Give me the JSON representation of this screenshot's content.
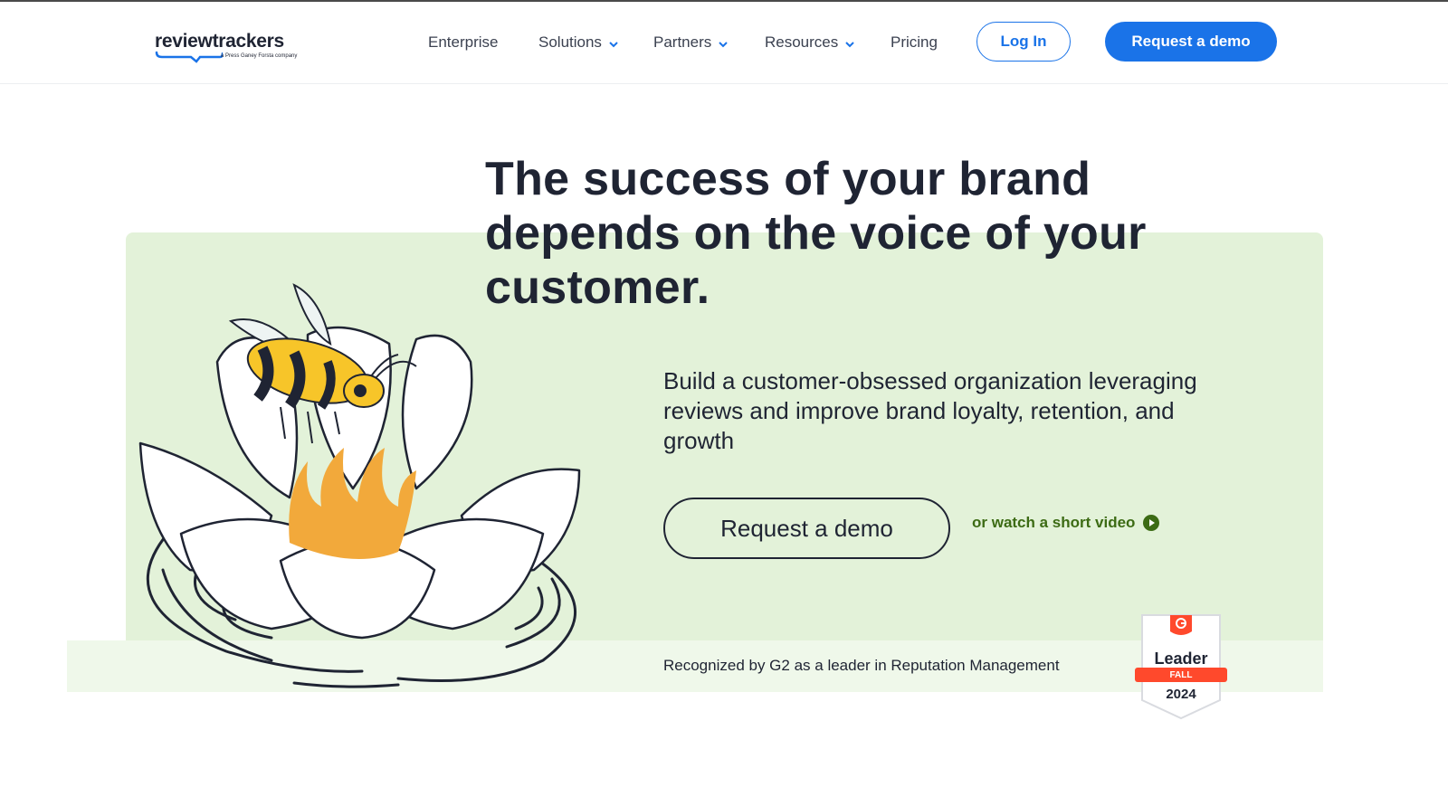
{
  "brand": {
    "name": "reviewtrackers",
    "tagline": "a Press Ganey Forsta company",
    "accent": "#1a73e8",
    "hero_bg": "#e3f2d9",
    "text_dark": "#1f2433",
    "link_green": "#3c6b14"
  },
  "nav": {
    "items": [
      {
        "label": "Enterprise",
        "has_dropdown": false
      },
      {
        "label": "Solutions",
        "has_dropdown": true
      },
      {
        "label": "Partners",
        "has_dropdown": true
      },
      {
        "label": "Resources",
        "has_dropdown": true
      },
      {
        "label": "Pricing",
        "has_dropdown": false
      }
    ],
    "login_label": "Log In",
    "demo_label": "Request a demo",
    "dropdown_icon": "chevron-down-icon"
  },
  "hero": {
    "headline": "The success of your brand depends on the voice of your customer.",
    "subhead": "Build a customer-obsessed organization leveraging reviews and improve brand loyalty, retention, and growth",
    "cta_label": "Request a demo",
    "video_link": "or watch a short video",
    "video_icon": "play-circle-icon",
    "illustration": "bee-on-water-lily-icon"
  },
  "recognition": {
    "text": "Recognized by G2 as a leader in Reputation Management",
    "badge": {
      "icon": "g2-logo-icon",
      "title": "Leader",
      "season": "FALL",
      "year": "2024"
    }
  }
}
